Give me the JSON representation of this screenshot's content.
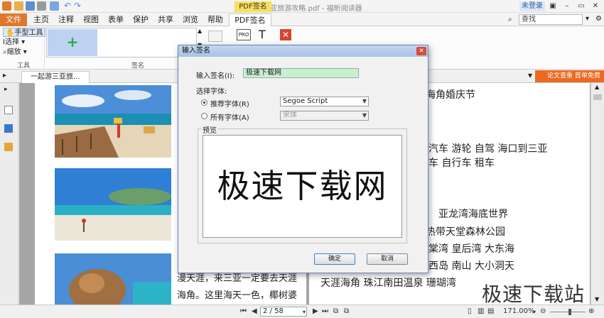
{
  "window": {
    "title": "一起游三亚旅游攻略.pdf - 福昕阅读器",
    "context_tab": "PDF签名",
    "login": "未登录"
  },
  "menu": {
    "tabs": [
      "文件",
      "主页",
      "注释",
      "视图",
      "表单",
      "保护",
      "共享",
      "浏览",
      "帮助",
      "PDF签名"
    ],
    "search_placeholder": "查找"
  },
  "ribbon": {
    "tools": [
      "手型工具",
      "选择",
      "缩放"
    ],
    "tools_group": "工具",
    "sign_group": "签名",
    "plus": "+"
  },
  "doc_tab": {
    "label": "一起游三亚旅...",
    "promo": "论文查重 首单免费"
  },
  "document": {
    "right_lines": [
      "海角婚庆节",
      "汽车  游轮  自驾  海口到三亚",
      "车  自行车  租车",
      "亚龙湾海底世界",
      "热带天堂森林公园",
      "棠湾  皇后湾  大东海",
      "西岛  南山  大小洞天",
      "天涯海角  珠江南田温泉  珊瑚湾"
    ],
    "left_lines": [
      "漫天涯，来三亚一定要去天涯",
      "海角。这里海天一色，椰树婆"
    ]
  },
  "status": {
    "page": "2 / 58",
    "zoom": "171.00%"
  },
  "watermark": "极速下载站",
  "dialog": {
    "title": "输入签名",
    "input_label": "输入签名(I):",
    "input_value": "极速下载网",
    "font_section": "选择字体:",
    "recommended_label": "推荐字体(R)",
    "recommended_font": "Segoe Script",
    "all_fonts_label": "所有字体(A)",
    "all_fonts_value": "宋体",
    "preview_label": "预览",
    "preview_text": "极速下载网",
    "ok": "确定",
    "cancel": "取消"
  }
}
